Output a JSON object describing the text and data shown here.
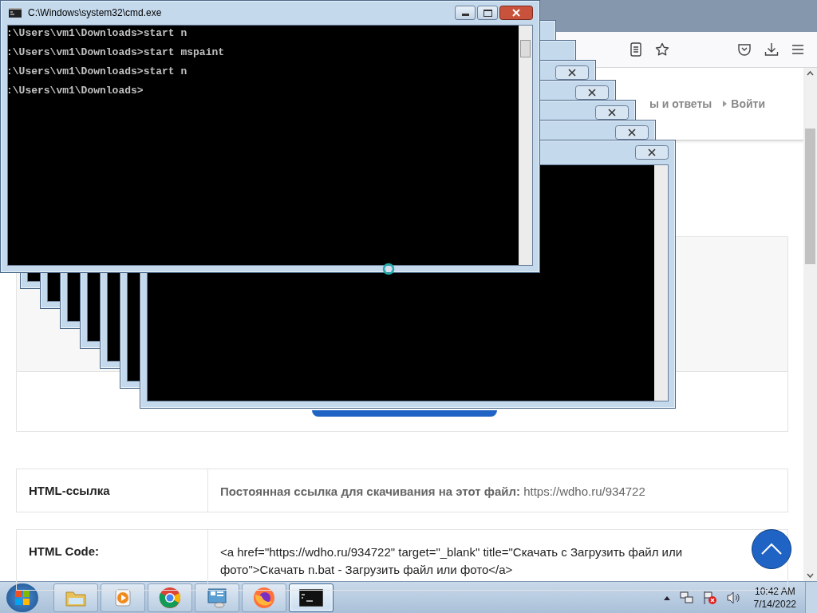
{
  "browser": {
    "nav_links": [
      {
        "label": "ы и ответы",
        "kind": "plain"
      },
      {
        "label": "Войти",
        "kind": "arrow"
      }
    ],
    "info_rows": [
      {
        "label": "HTML-ссылка",
        "value": "**Постоянная ссылка для скачивания на этот файл:** https://wdho.ru/934722"
      },
      {
        "label": "HTML Code:",
        "value": "<a href=\"https://wdho.ru/934722\" target=\"_blank\" title=\"Скачать с Загрузить файл или фото\">Скачать n.bat - Загрузить файл или фото</a>"
      }
    ]
  },
  "stacked_windows": [
    {
      "kind": "console"
    },
    {
      "kind": "console"
    },
    {
      "kind": "console"
    },
    {
      "kind": "console"
    },
    {
      "kind": "console"
    },
    {
      "kind": "console"
    },
    {
      "kind": "console"
    }
  ],
  "console": {
    "title": "C:\\Windows\\system32\\cmd.exe",
    "lines": [
      ":\\Users\\vm1\\Downloads>start n",
      ":\\Users\\vm1\\Downloads>start mspaint",
      ":\\Users\\vm1\\Downloads>start n",
      ":\\Users\\vm1\\Downloads>"
    ]
  },
  "taskbar": {
    "items": [
      {
        "kind": "explorer",
        "selected": false
      },
      {
        "kind": "media",
        "selected": false
      },
      {
        "kind": "chrome",
        "selected": false
      },
      {
        "kind": "control",
        "selected": false
      },
      {
        "kind": "firefox",
        "selected": false
      },
      {
        "kind": "cmd",
        "selected": true
      }
    ],
    "time": "10:42 AM",
    "date": "7/14/2022"
  }
}
